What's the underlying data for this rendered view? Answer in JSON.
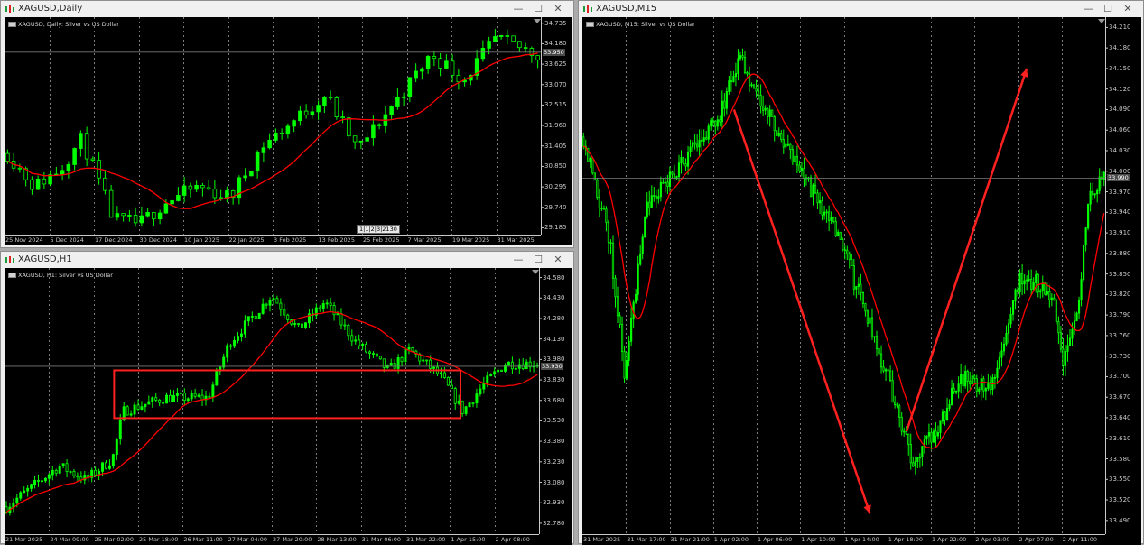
{
  "app": {
    "up_color": "#00ff00",
    "down_color": "#00ff00",
    "ma_color": "#ff0000",
    "annotation_color": "#ff2020",
    "window_buttons": [
      "—",
      "☐",
      "✕"
    ]
  },
  "windows": {
    "daily": {
      "title": "XAGUSD,Daily",
      "symbol_desc": "XAGUSD, Daily:  Silver vs US Dollar",
      "current_price": "33.950",
      "price_labels": [
        "34.735",
        "34.180",
        "33.625",
        "33.070",
        "32.515",
        "31.960",
        "31.405",
        "30.850",
        "30.295",
        "29.740",
        "29.185"
      ],
      "time_labels": [
        "25 Nov 2024",
        "5 Dec 2024",
        "17 Dec 2024",
        "30 Dec 2024",
        "10 Jan 2025",
        "22 Jan 2025",
        "3 Feb 2025",
        "13 Feb 2025",
        "25 Feb 2025",
        "7 Mar 2025",
        "19 Mar 2025",
        "31 Mar 2025"
      ],
      "badge": "1|1|2|3|2130"
    },
    "h1": {
      "title": "XAGUSD,H1",
      "symbol_desc": "XAGUSD, H1:  Silver vs US Dollar",
      "current_price": "33.930",
      "price_labels": [
        "34.580",
        "34.430",
        "34.280",
        "34.130",
        "33.980",
        "33.830",
        "33.680",
        "33.530",
        "33.380",
        "33.230",
        "33.080",
        "32.930",
        "32.780"
      ],
      "time_labels": [
        "21 Mar 2025",
        "24 Mar 09:00",
        "25 Mar 02:00",
        "25 Mar 18:00",
        "26 Mar 11:00",
        "27 Mar 04:00",
        "27 Mar 20:00",
        "28 Mar 13:00",
        "31 Mar 06:00",
        "31 Mar 22:00",
        "1 Apr 15:00",
        "2 Apr 08:00"
      ]
    },
    "m15": {
      "title": "XAGUSD,M15",
      "symbol_desc": "XAGUSD, M15:  Silver vs US Dollar",
      "current_price": "33.990",
      "price_labels": [
        "34.210",
        "34.180",
        "34.150",
        "34.120",
        "34.090",
        "34.060",
        "34.030",
        "34.000",
        "33.970",
        "33.940",
        "33.910",
        "33.880",
        "33.850",
        "33.820",
        "33.790",
        "33.760",
        "33.730",
        "33.700",
        "33.670",
        "33.640",
        "33.610",
        "33.580",
        "33.550",
        "33.520",
        "33.490"
      ],
      "time_labels": [
        "31 Mar 2025",
        "31 Mar 17:00",
        "31 Mar 21:00",
        "1 Apr 02:00",
        "1 Apr 06:00",
        "1 Apr 10:00",
        "1 Apr 14:00",
        "1 Apr 18:00",
        "1 Apr 22:00",
        "2 Apr 03:00",
        "2 Apr 07:00",
        "2 Apr 11:00"
      ]
    }
  },
  "chart_data": [
    {
      "type": "candlestick",
      "title": "XAGUSD, Daily:  Silver vs US Dollar",
      "ylim": [
        29.0,
        34.9
      ],
      "last_close": 33.95,
      "ma_points_approx": [
        [
          0,
          31.3
        ],
        [
          0.08,
          30.75
        ],
        [
          0.16,
          30.55
        ],
        [
          0.24,
          30.25
        ],
        [
          0.32,
          29.85
        ],
        [
          0.36,
          29.65
        ],
        [
          0.4,
          29.6
        ],
        [
          0.46,
          30.0
        ],
        [
          0.52,
          30.55
        ],
        [
          0.58,
          31.1
        ],
        [
          0.64,
          31.55
        ],
        [
          0.7,
          31.85
        ],
        [
          0.76,
          31.95
        ],
        [
          0.82,
          32.25
        ],
        [
          0.88,
          32.75
        ],
        [
          0.93,
          33.15
        ],
        [
          0.97,
          33.55
        ],
        [
          1.0,
          33.7
        ]
      ],
      "trend": [
        "down to ~29.2 late Dec 2024",
        "rally to ~34.6 late Mar 2025"
      ]
    },
    {
      "type": "candlestick",
      "title": "XAGUSD, H1:  Silver vs US Dollar",
      "ylim": [
        32.7,
        34.65
      ],
      "last_close": 33.93,
      "annotations": [
        {
          "type": "rectangle",
          "price_range": [
            33.55,
            33.9
          ],
          "from": "25 Mar 18:00",
          "to": "2 Apr 08:00"
        }
      ]
    },
    {
      "type": "candlestick",
      "title": "XAGUSD, M15:  Silver vs US Dollar",
      "ylim": [
        33.47,
        34.225
      ],
      "last_close": 33.99,
      "annotations": [
        {
          "type": "arrow",
          "from": {
            "time": "1 Apr 06:00",
            "price": 34.09
          },
          "to": {
            "time": "1 Apr 18:00",
            "price": 33.5
          }
        },
        {
          "type": "arrow",
          "from": {
            "time": "1 Apr 22:00",
            "price": 33.62
          },
          "to": {
            "time": "2 Apr 11:00",
            "price": 34.15
          }
        }
      ]
    }
  ]
}
